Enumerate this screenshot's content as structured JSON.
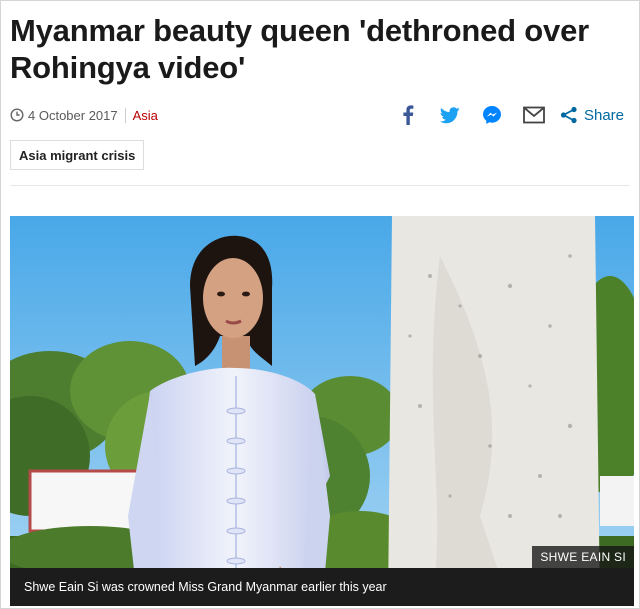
{
  "article": {
    "headline": "Myanmar beauty queen 'dethroned over Rohingya video'",
    "date": "4 October 2017",
    "section": "Asia",
    "tag": "Asia migrant crisis"
  },
  "share": {
    "label": "Share",
    "icons": [
      "facebook-icon",
      "twitter-icon",
      "messenger-icon",
      "email-icon",
      "share-icon"
    ]
  },
  "image": {
    "credit": "SHWE EAIN SI",
    "caption": "Shwe Eain Si was crowned Miss Grand Myanmar earlier this year"
  },
  "colors": {
    "section_link": "#b80000",
    "share_blue": "#0068a1",
    "facebook": "#3b5998",
    "twitter": "#1da1f2",
    "messenger": "#0084ff"
  }
}
